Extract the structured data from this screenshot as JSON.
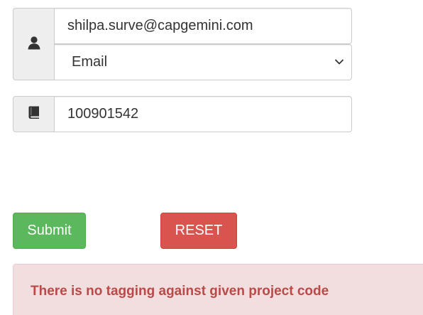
{
  "form": {
    "user_group": {
      "icon": "user-icon",
      "email_value": "shilpa.surve@capgemini.com",
      "identifier_type": {
        "selected": "Email",
        "icon": "chevron-down-icon"
      }
    },
    "project_group": {
      "icon": "book-icon",
      "code_value": "100901542"
    },
    "buttons": {
      "submit_label": "Submit",
      "reset_label": "RESET"
    },
    "alert": {
      "message": "There is no tagging against given project code"
    }
  },
  "colors": {
    "addon_bg": "#eeeeee",
    "field_border": "#cccccc",
    "submit_bg": "#5cb85c",
    "reset_bg": "#d9534f",
    "alert_bg": "#f2dede",
    "alert_text": "#b94a48"
  }
}
